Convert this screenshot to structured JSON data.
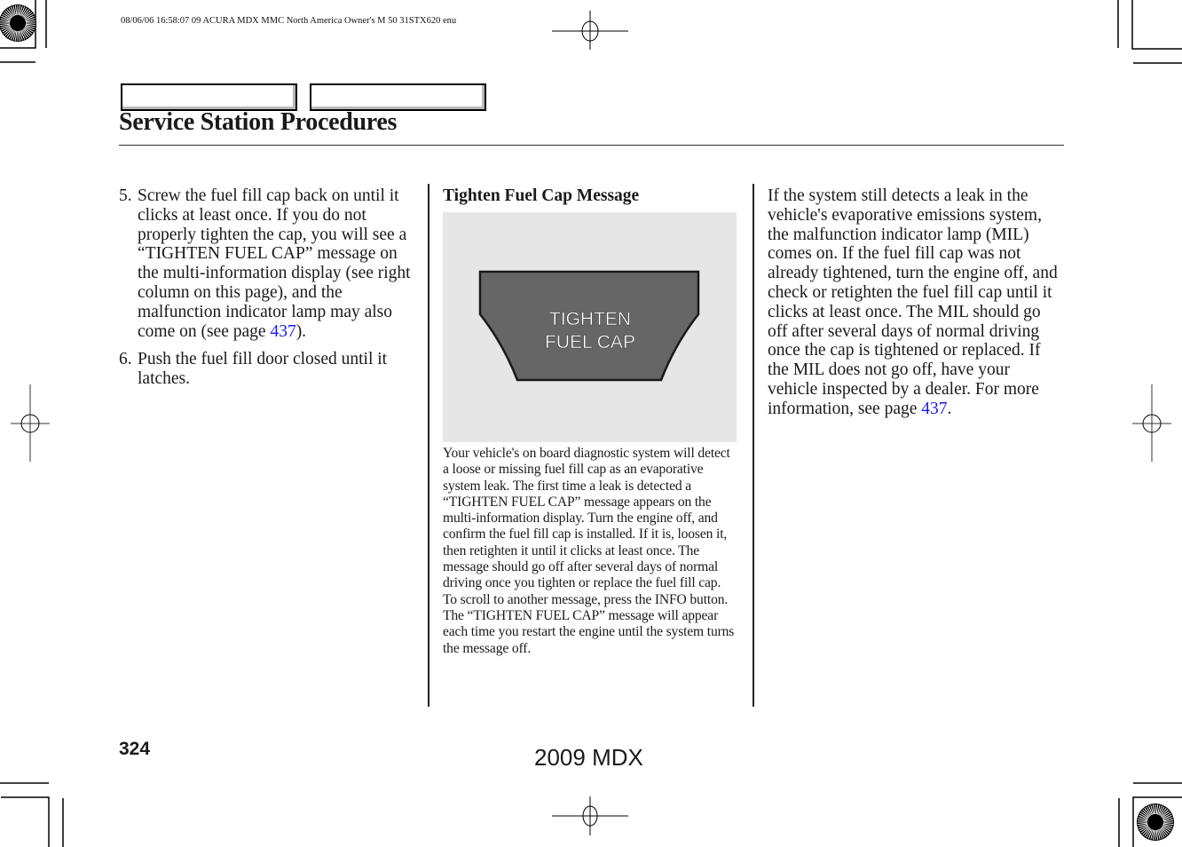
{
  "print_header": "08/06/06 16:58:07    09 ACURA MDX MMC North America Owner's M 50 31STX620 enu",
  "section_title": "Service Station Procedures",
  "left_column": {
    "steps": [
      {
        "number": "5.",
        "text_before_link": "Screw the fuel fill cap back on until it clicks at least once. If you do not properly tighten the cap, you will see a “TIGHTEN FUEL CAP” message on the multi-information display (see right column on this page), and the malfunction indicator lamp may also come on (see page ",
        "link": "437",
        "text_after_link": ")."
      },
      {
        "number": "6.",
        "text_before_link": "Push the fuel fill door closed until it latches.",
        "link": null,
        "text_after_link": ""
      }
    ]
  },
  "middle_column": {
    "heading": "Tighten Fuel Cap Message",
    "figure": {
      "display_line1": "TIGHTEN",
      "display_line2": "FUEL CAP",
      "display_color": "#666666",
      "background_color": "#e6e6e6"
    },
    "caption": "Your vehicle's on board diagnostic system will detect a loose or missing fuel fill cap as an evaporative system leak. The first time a leak is detected a “TIGHTEN FUEL CAP” message appears on the multi-information display. Turn the engine off, and confirm the fuel fill cap is installed. If it is, loosen it, then retighten it until it clicks at least once. The message should go off after several days of normal driving once you tighten or replace the fuel fill cap. To scroll to another message, press the INFO button. The “TIGHTEN FUEL CAP” message will appear each time you restart the engine until the system turns the message off."
  },
  "right_column": {
    "text_before_link": "If the system still detects a leak in the vehicle's evaporative emissions system, the malfunction indicator lamp (MIL) comes on. If the fuel fill cap was not already tightened, turn the engine off, and check or retighten the fuel fill cap until it clicks at least once. The MIL should go off after several days of normal driving once the cap is tightened or replaced. If the MIL does not go off, have your vehicle inspected by a dealer. For more information, see page ",
    "link": "437",
    "text_after_link": "."
  },
  "footer": {
    "page_number": "324",
    "model": "2009  MDX"
  },
  "colors": {
    "link": "#1a1aee",
    "text": "#1a1a1a"
  }
}
